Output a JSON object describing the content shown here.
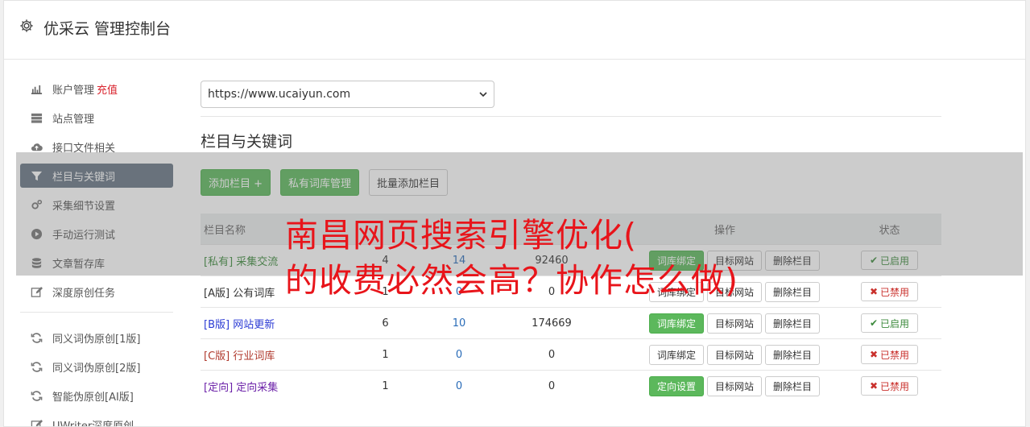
{
  "header": {
    "title": "优采云 管理控制台",
    "icon": "gear-icon"
  },
  "sidebar": {
    "items": [
      {
        "label": "账户管理",
        "extra": "充值",
        "icon": "bar-chart-icon"
      },
      {
        "label": "站点管理",
        "icon": "server-icon"
      },
      {
        "label": "接口文件相关",
        "icon": "cloud-upload-icon"
      },
      {
        "label": "栏目与关键词",
        "icon": "filter-icon",
        "active": true
      },
      {
        "label": "采集细节设置",
        "icon": "cogs-icon"
      },
      {
        "label": "手动运行测试",
        "icon": "play-circle-icon"
      },
      {
        "label": "文章暂存库",
        "icon": "database-icon"
      },
      {
        "label": "深度原创任务",
        "icon": "edit-icon"
      }
    ],
    "items2": [
      {
        "label": "同义词伪原创[1版]",
        "icon": "refresh-icon"
      },
      {
        "label": "同义词伪原创[2版]",
        "icon": "refresh-icon"
      },
      {
        "label": "智能伪原创[AI版]",
        "icon": "refresh-icon"
      },
      {
        "label": "UWriter深度原创",
        "icon": "edit-icon"
      }
    ]
  },
  "main": {
    "site_select": "https://www.ucaiyun.com",
    "section_title": "栏目与关键词",
    "buttons": {
      "add": "添加栏目 +",
      "private": "私有词库管理",
      "batch": "批量添加栏目"
    },
    "table": {
      "headers": {
        "name": "栏目名称",
        "ops": "操作",
        "status": "状态"
      },
      "rows": [
        {
          "tag": "[私有]",
          "name": "采集交流",
          "n1": "4",
          "n2": "14",
          "n3": "92460",
          "op1": "词库绑定",
          "op2": "目标网站",
          "op3": "删除栏目",
          "status": "已启用",
          "color": "#3c8a3c"
        },
        {
          "tag": "[A版]",
          "name": "公有词库",
          "n1": "1",
          "n2": "0",
          "n3": "0",
          "op1": "词库绑定",
          "op2": "目标网站",
          "op3": "删除栏目",
          "status": "已禁用",
          "color": "#333333"
        },
        {
          "tag": "[B版]",
          "name": "网站更新",
          "n1": "6",
          "n2": "10",
          "n3": "174669",
          "op1": "词库绑定",
          "op2": "目标网站",
          "op3": "删除栏目",
          "status": "已启用",
          "color": "#2b3bd4"
        },
        {
          "tag": "[C版]",
          "name": "行业词库",
          "n1": "1",
          "n2": "0",
          "n3": "0",
          "op1": "词库绑定",
          "op2": "目标网站",
          "op3": "删除栏目",
          "status": "已禁用",
          "color": "#b03a2e"
        },
        {
          "tag": "[定向]",
          "name": "定向采集",
          "n1": "1",
          "n2": "0",
          "n3": "0",
          "op1": "定向设置",
          "op2": "目标网站",
          "op3": "删除栏目",
          "status": "已禁用",
          "color": "#6b21a8"
        }
      ]
    }
  },
  "overlay_headline": {
    "line1": "南昌网页搜索引擎优化(",
    "line2": "的收费必然会高？协作怎么做)"
  }
}
